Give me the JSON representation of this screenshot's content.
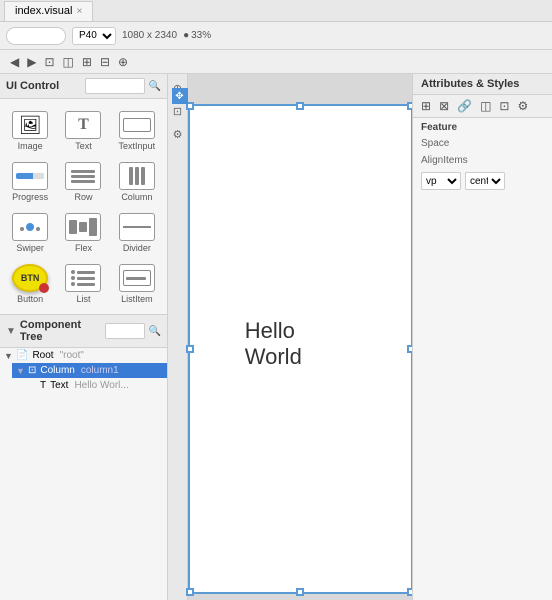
{
  "tab": {
    "label": "index.visual",
    "close": "×"
  },
  "topbar": {
    "search_placeholder": "",
    "device": "P40",
    "resolution": "1080 x 2340",
    "zoom": "33%",
    "zoom_icon": "●",
    "nav_back": "◀",
    "nav_forward": "▶",
    "icon1": "⊡",
    "icon2": "◫",
    "icon3": "⊞",
    "icon4": "⊟",
    "icon5": "⊕"
  },
  "left_panel": {
    "title": "UI Control",
    "search_placeholder": "",
    "controls": [
      {
        "id": "image",
        "label": "Image",
        "type": "image"
      },
      {
        "id": "text",
        "label": "Text",
        "type": "text"
      },
      {
        "id": "textinput",
        "label": "TextInput",
        "type": "textinput"
      },
      {
        "id": "progress",
        "label": "Progress",
        "type": "progress"
      },
      {
        "id": "row",
        "label": "Row",
        "type": "row"
      },
      {
        "id": "column",
        "label": "Column",
        "type": "column"
      },
      {
        "id": "swiper",
        "label": "Swiper",
        "type": "swiper"
      },
      {
        "id": "flex",
        "label": "Flex",
        "type": "flex"
      },
      {
        "id": "divider",
        "label": "Divider",
        "type": "divider"
      },
      {
        "id": "button",
        "label": "Button",
        "type": "button"
      },
      {
        "id": "list",
        "label": "List",
        "type": "list"
      },
      {
        "id": "listitem",
        "label": "ListItem",
        "type": "listitem"
      }
    ]
  },
  "component_tree": {
    "title": "Component Tree",
    "search_placeholder": "",
    "items": [
      {
        "id": "root",
        "label": "Root",
        "value": "\"root\"",
        "indent": 0,
        "expanded": true,
        "selected": false
      },
      {
        "id": "column",
        "label": "Column",
        "value": "column1",
        "indent": 1,
        "expanded": true,
        "selected": true
      },
      {
        "id": "text",
        "label": "Text",
        "value": "Hello Worl...",
        "indent": 2,
        "expanded": false,
        "selected": false
      }
    ]
  },
  "canvas": {
    "hello_world": "Hello World"
  },
  "right_panel": {
    "title": "Attributes & Styles",
    "feature_label": "Feature",
    "space_label": "Space",
    "alignitems_label": "AlignItems",
    "vp_value": "vp",
    "center_value": "center",
    "icons": [
      "⊞",
      "⊟",
      "🔗",
      "⊠",
      "⊡",
      "⊢"
    ],
    "gear_icon": "⚙",
    "side_icons": [
      "⊞",
      "⊠",
      "⊡",
      "🔗"
    ]
  }
}
